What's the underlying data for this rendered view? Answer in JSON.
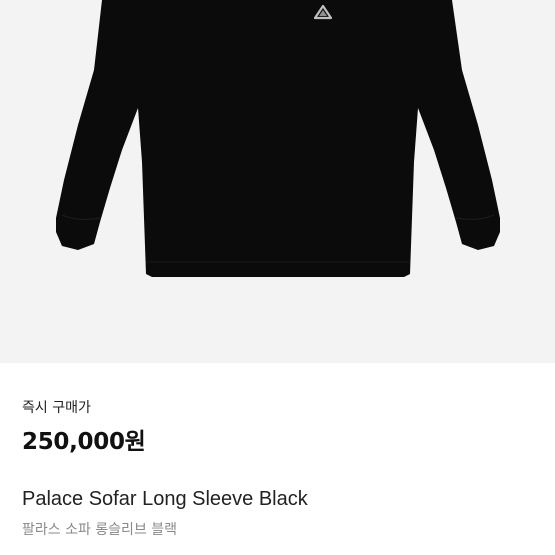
{
  "product": {
    "image_alt": "Palace Sofar Long Sleeve Black",
    "logo_icon": "palace-triangle-logo-icon",
    "garment_color": "#0b0b0b",
    "image_background": "#f3f3f3"
  },
  "purchase": {
    "label": "즉시 구매가",
    "price": "250,000원"
  },
  "title": {
    "english": "Palace Sofar Long Sleeve Black",
    "korean": "팔라스 소파 롱슬리브 블랙"
  }
}
